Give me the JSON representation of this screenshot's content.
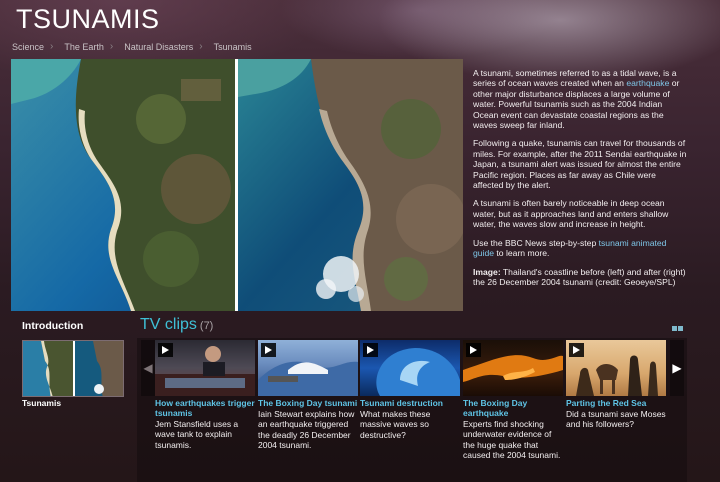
{
  "page": {
    "title": "TSUNAMIS",
    "breadcrumb": [
      "Science",
      "The Earth",
      "Natural Disasters",
      "Tsunamis"
    ]
  },
  "article": {
    "p1_before": "A tsunami, sometimes referred to as a tidal wave, is a series of ocean waves created when an ",
    "p1_link": "earthquake",
    "p1_after": " or other major disturbance displaces a large volume of water. Powerful tsunamis such as the 2004 Indian Ocean event can devastate coastal regions as the waves sweep far inland.",
    "p2": "Following a quake, tsunamis can travel for thousands of miles. For example, after the 2011 Sendai earthquake in Japan, a tsunami alert was issued for almost the entire Pacific region. Places as far away as Chile were affected by the alert.",
    "p3": "A tsunami is often barely noticeable in deep ocean water, but as it approaches land and enters shallow water, the waves slow and increase in height.",
    "p4_before": "Use the BBC News step-by-step ",
    "p4_link": "tsunami animated guide",
    "p4_after": " to learn more.",
    "caption_label": "Image:",
    "caption_text": " Thailand's coastline before (left) and after (right) the 26 December 2004 tsunami (credit: Geoeye/SPL)"
  },
  "intro": {
    "heading": "Introduction",
    "caption": "Tsunamis"
  },
  "clips": {
    "heading": "TV clips",
    "count": "(7)",
    "items": [
      {
        "title": "How earthquakes trigger tsunamis",
        "desc": "Jem Stansfield uses a wave tank to explain tsunamis."
      },
      {
        "title": "The Boxing Day tsunami",
        "desc": "Iain Stewart explains how an earthquake triggered the deadly 26 December 2004 tsunami."
      },
      {
        "title": "Tsunami destruction",
        "desc": "What makes these massive waves so destructive?"
      },
      {
        "title": "The Boxing Day earthquake",
        "desc": "Experts find shocking underwater evidence of the huge quake that caused the 2004 tsunami."
      },
      {
        "title": "Parting the Red Sea",
        "desc": "Did a tsunami save Moses and his followers?"
      }
    ]
  },
  "icons": {
    "play": "play-icon",
    "prev": "chevron-left-icon",
    "next": "chevron-right-icon",
    "grid_view": "grid-view-icon"
  },
  "colors": {
    "accent": "#3fc0d6",
    "link": "#7ec6e8",
    "clip_title": "#5fc4e6"
  }
}
